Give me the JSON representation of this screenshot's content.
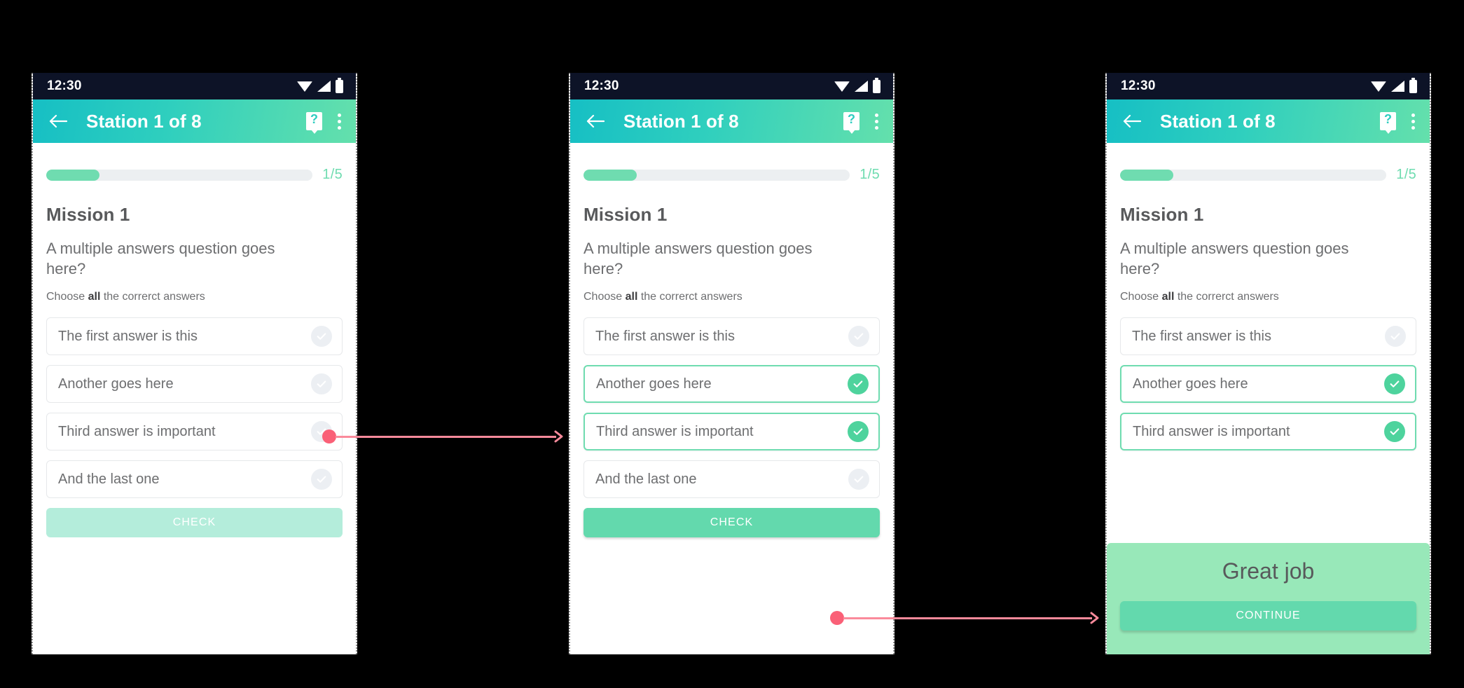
{
  "status_bar": {
    "time": "12:30",
    "icons": [
      "wifi-icon",
      "signal-icon",
      "battery-icon"
    ]
  },
  "app_bar": {
    "title": "Station 1 of 8",
    "back_icon": "back-arrow-icon",
    "help_icon": "help-icon",
    "overflow_icon": "overflow-menu-icon"
  },
  "progress": {
    "label": "1/5",
    "percent": 20,
    "fill_color": "#6fdcb0",
    "track_color": "#eceff1"
  },
  "mission": {
    "title": "Mission 1",
    "question": "A multiple answers question goes here?",
    "hint_prefix": "Choose ",
    "hint_bold": "all",
    "hint_suffix": " the correrct answers"
  },
  "options": [
    {
      "label": "The first answer is this",
      "selected": false
    },
    {
      "label": "Another goes here",
      "selected": false
    },
    {
      "label": "Third answer is important",
      "selected": false
    },
    {
      "label": "And the last one",
      "selected": false
    }
  ],
  "options_selected": [
    {
      "label": "The first answer is this",
      "selected": false
    },
    {
      "label": "Another goes here",
      "selected": true
    },
    {
      "label": "Third answer is important",
      "selected": true
    },
    {
      "label": "And the last one",
      "selected": false
    }
  ],
  "options_result": [
    {
      "label": "The first answer is this",
      "selected": false
    },
    {
      "label": "Another goes here",
      "selected": true
    },
    {
      "label": "Third answer is important",
      "selected": true
    }
  ],
  "buttons": {
    "check_label": "CHECK",
    "continue_label": "CONTINUE"
  },
  "feedback": {
    "title": "Great job",
    "panel_color": "#98e8b9"
  },
  "colors": {
    "accent_green": "#63d9ad",
    "accent_teal": "#16bfc4",
    "annotation_pink": "#fa6077",
    "status_bar": "#0d1327",
    "text_primary": "#58595b",
    "text_secondary": "#6d6e70"
  },
  "screens": [
    {
      "name": "initial-state",
      "options_key": "options"
    },
    {
      "name": "selected-state",
      "options_key": "options_selected"
    },
    {
      "name": "success-state",
      "options_key": "options_result"
    }
  ]
}
